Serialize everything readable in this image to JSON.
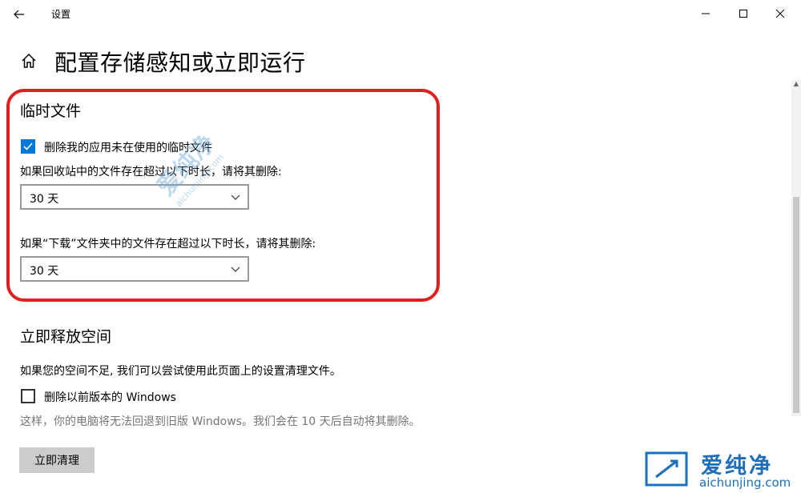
{
  "window": {
    "title": "设置"
  },
  "page": {
    "title": "配置存储感知或立即运行"
  },
  "temp_files": {
    "heading": "临时文件",
    "delete_temp_label": "删除我的应用未在使用的临时文件",
    "delete_temp_checked": true,
    "recycle_bin_prompt": "如果回收站中的文件存在超过以下时长，请将其删除:",
    "recycle_bin_value": "30 天",
    "downloads_prompt": "如果“下载”文件夹中的文件存在超过以下时长，请将其删除:",
    "downloads_value": "30 天"
  },
  "free_space": {
    "heading": "立即释放空间",
    "description": "如果您的空间不足, 我们可以尝试使用此页面上的设置清理文件。",
    "delete_prev_windows_label": "删除以前版本的 Windows",
    "delete_prev_windows_checked": false,
    "note": "这样，你的电脑将无法回退到旧版 Windows。我们会在 10 天后自动将其删除。",
    "clean_button": "立即清理"
  },
  "watermark": {
    "brand_cn": "爱纯净",
    "brand_url": "aichunjing.com"
  },
  "icons": {
    "back": "back-arrow-icon",
    "home": "home-icon",
    "minimize": "minimize-icon",
    "maximize": "maximize-icon",
    "close": "close-icon",
    "chevron": "chevron-down-icon",
    "check": "checkmark-icon"
  },
  "colors": {
    "accent": "#0078d7",
    "highlight": "#e02020",
    "muted_text": "#767676",
    "button_bg": "#cccccc",
    "logo": "#1c6fb8"
  }
}
